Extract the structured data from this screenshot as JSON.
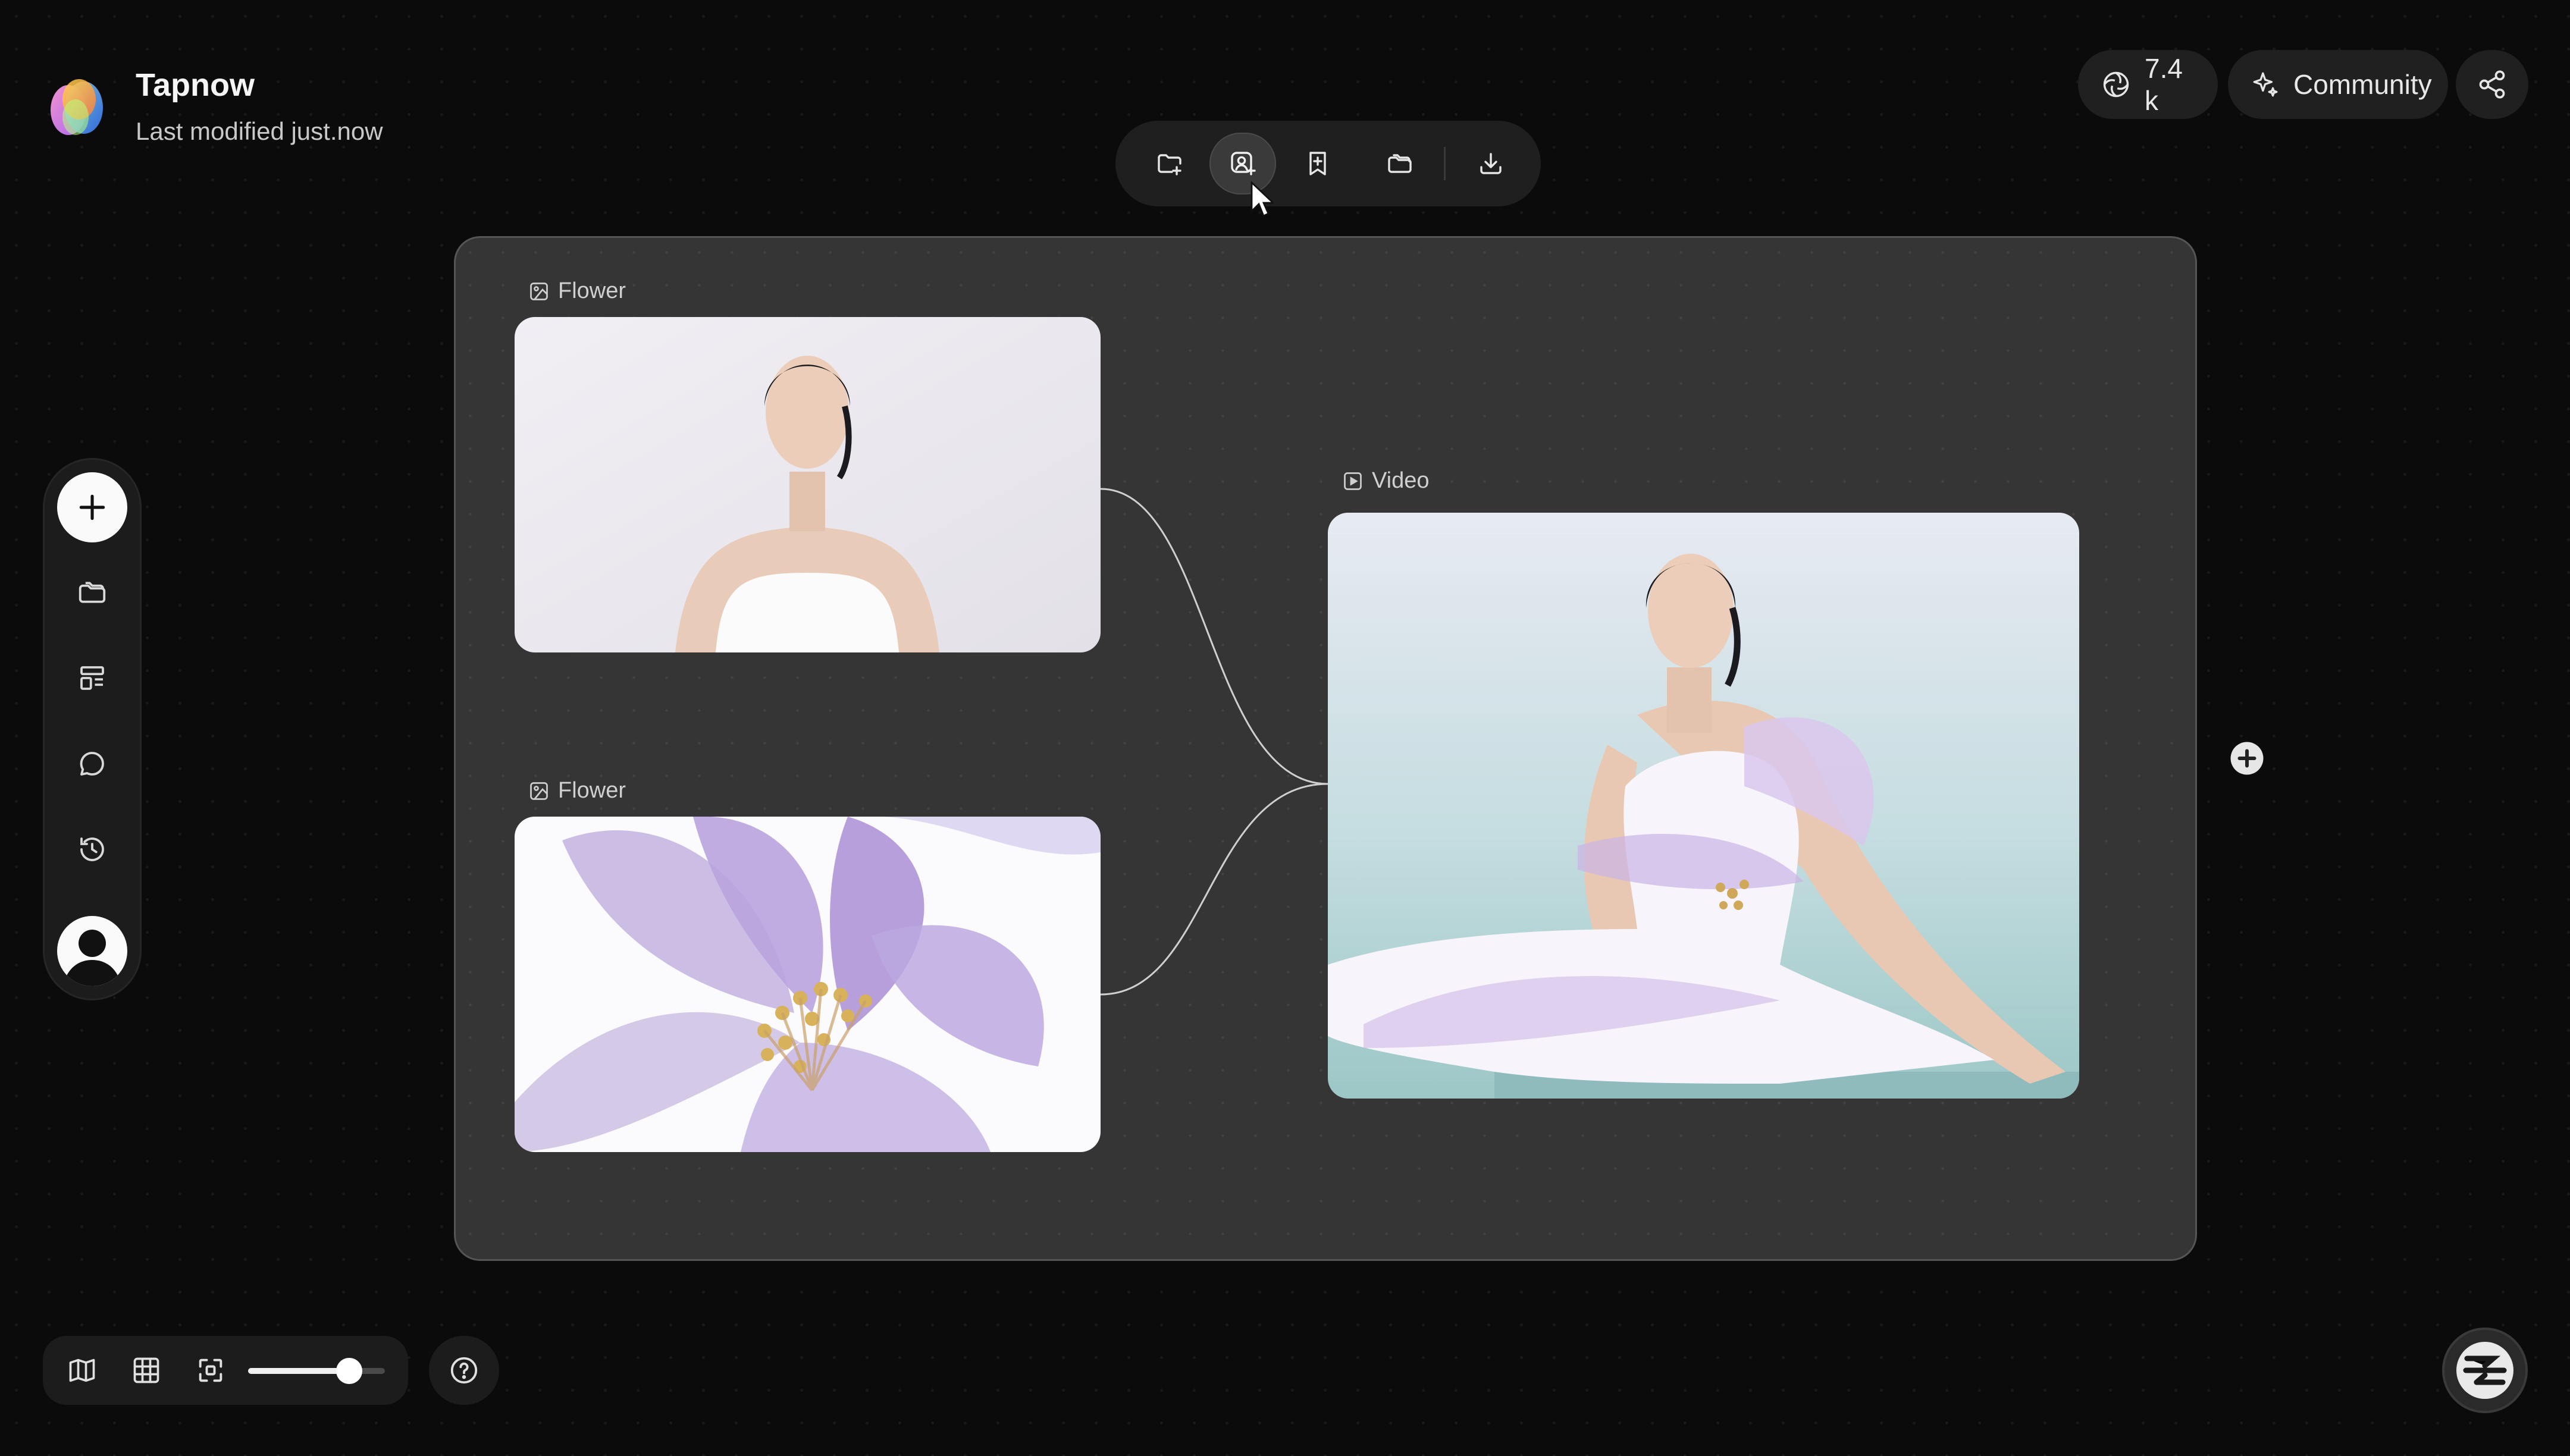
{
  "app": {
    "title": "Tapnow",
    "subtitle": "Last modified just.now"
  },
  "toolbar": {
    "items": [
      {
        "icon": "folder-add-icon",
        "active": false
      },
      {
        "icon": "user-add-icon",
        "active": true
      },
      {
        "icon": "bookmark-add-icon",
        "active": false
      },
      {
        "icon": "folders-icon",
        "active": false
      },
      {
        "icon": "download-icon",
        "active": false
      }
    ]
  },
  "header_right": {
    "count_label": "7.4 k",
    "count_icon": "openai-icon",
    "community_label": "Community",
    "community_icon": "sparkle-icon",
    "share_icon": "share-icon"
  },
  "sidebar": {
    "items": [
      "add-icon",
      "folders-icon",
      "layout-icon",
      "chat-icon",
      "history-icon",
      "avatar"
    ]
  },
  "canvas": {
    "nodes": [
      {
        "type_icon": "image-icon",
        "label": "Flower",
        "content": "woman-portrait"
      },
      {
        "type_icon": "image-icon",
        "label": "Flower",
        "content": "lilac-flower"
      },
      {
        "type_icon": "video-icon",
        "label": "Video",
        "content": "woman-in-flower-dress"
      }
    ]
  },
  "bottom_controls": {
    "icons": [
      "map-icon",
      "grid-icon",
      "fit-screen-icon"
    ],
    "zoom_fraction": 0.74,
    "help_icon": "help-icon"
  },
  "colors": {
    "background": "#0b0b0b",
    "panel": "#1c1c1c",
    "canvas_group": "#353535",
    "accent_lilac": "#b9a3dd"
  }
}
